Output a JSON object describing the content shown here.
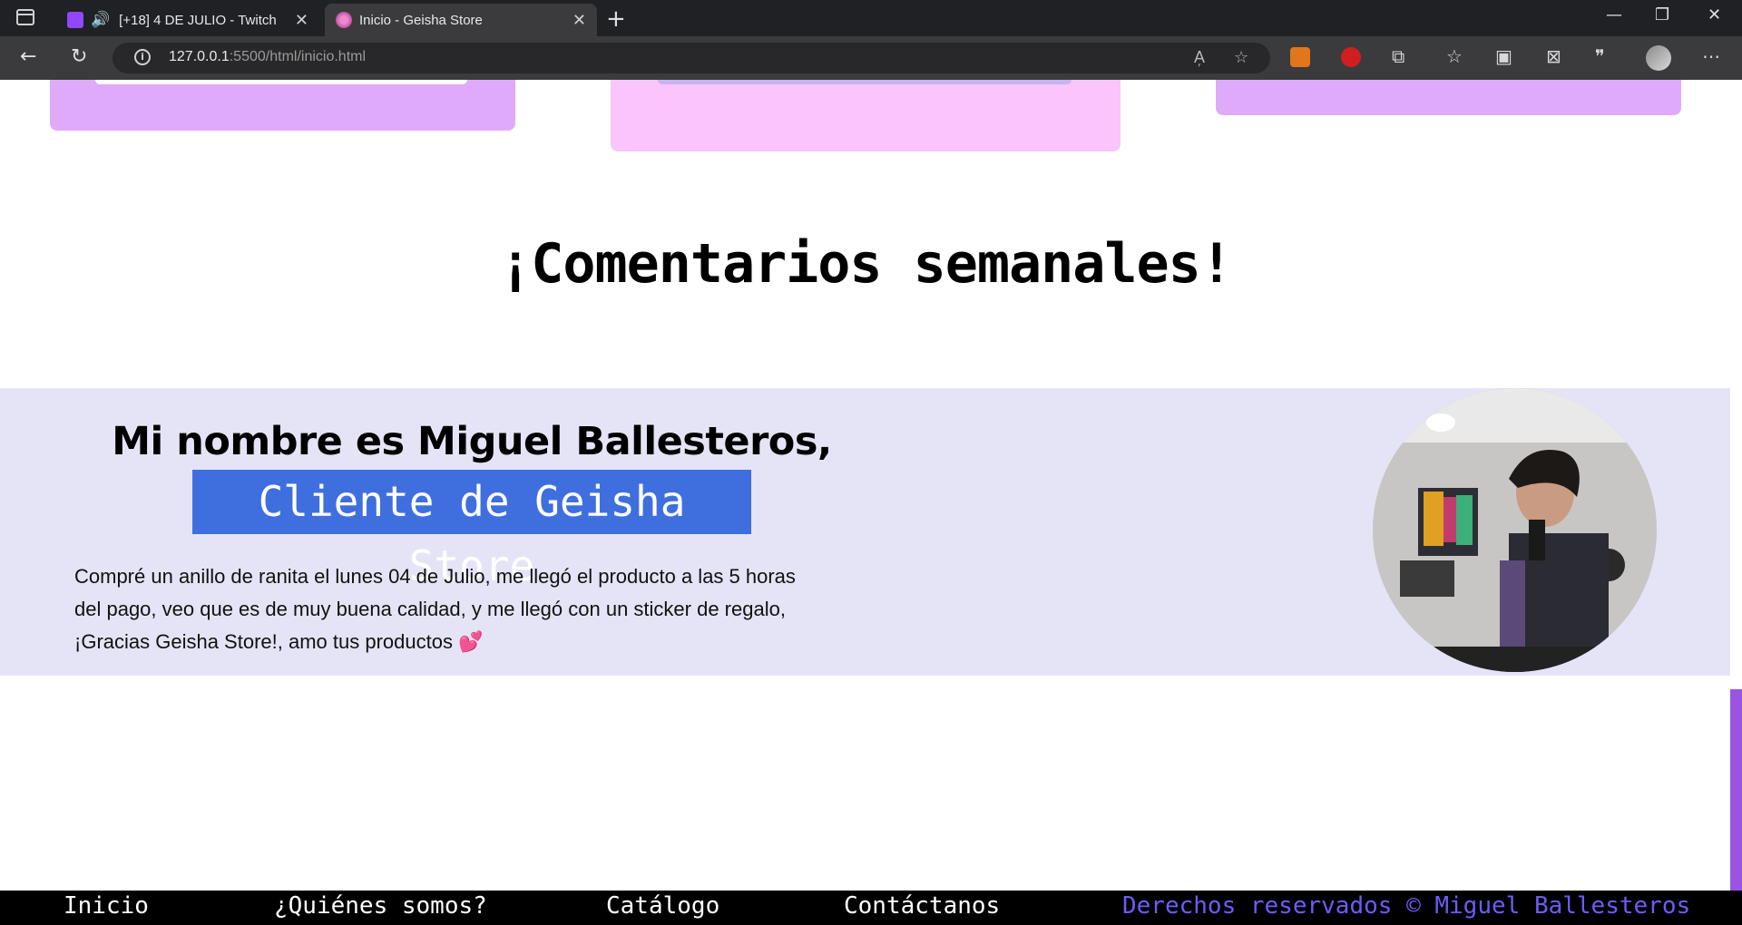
{
  "browser": {
    "tabs": [
      {
        "title": "[+18] 4 DE JULIO - Twitch",
        "active": false
      },
      {
        "title": "Inicio - Geisha Store",
        "active": true
      }
    ],
    "url_host": "127.0.0.1",
    "url_rest": ":5500/html/inicio.html"
  },
  "page": {
    "section_title": "¡Comentarios semanales!",
    "comment": {
      "name": "Mi nombre es Miguel Ballesteros,",
      "role": "Cliente de Geisha Store",
      "line1": "Compré un anillo de ranita el lunes 04 de Julio, me llegó el producto a las 5 horas",
      "line2": "del pago, veo que es de muy buena calidad, y me llegó con un sticker de regalo,",
      "line3": "¡Gracias Geisha Store!, amo tus productos",
      "heart": "💕"
    },
    "footer": {
      "links": [
        "Inicio",
        "¿Quiénes somos?",
        "Catálogo",
        "Contáctanos"
      ],
      "rights": "Derechos reservados © Miguel Ballesteros"
    }
  },
  "colors": {
    "card_purple": "#deaaf9",
    "card_pink": "#f9c5fc",
    "band": "#e5e4f6",
    "highlight": "#3f6fdf",
    "footer_accent": "#6b5cf7"
  }
}
